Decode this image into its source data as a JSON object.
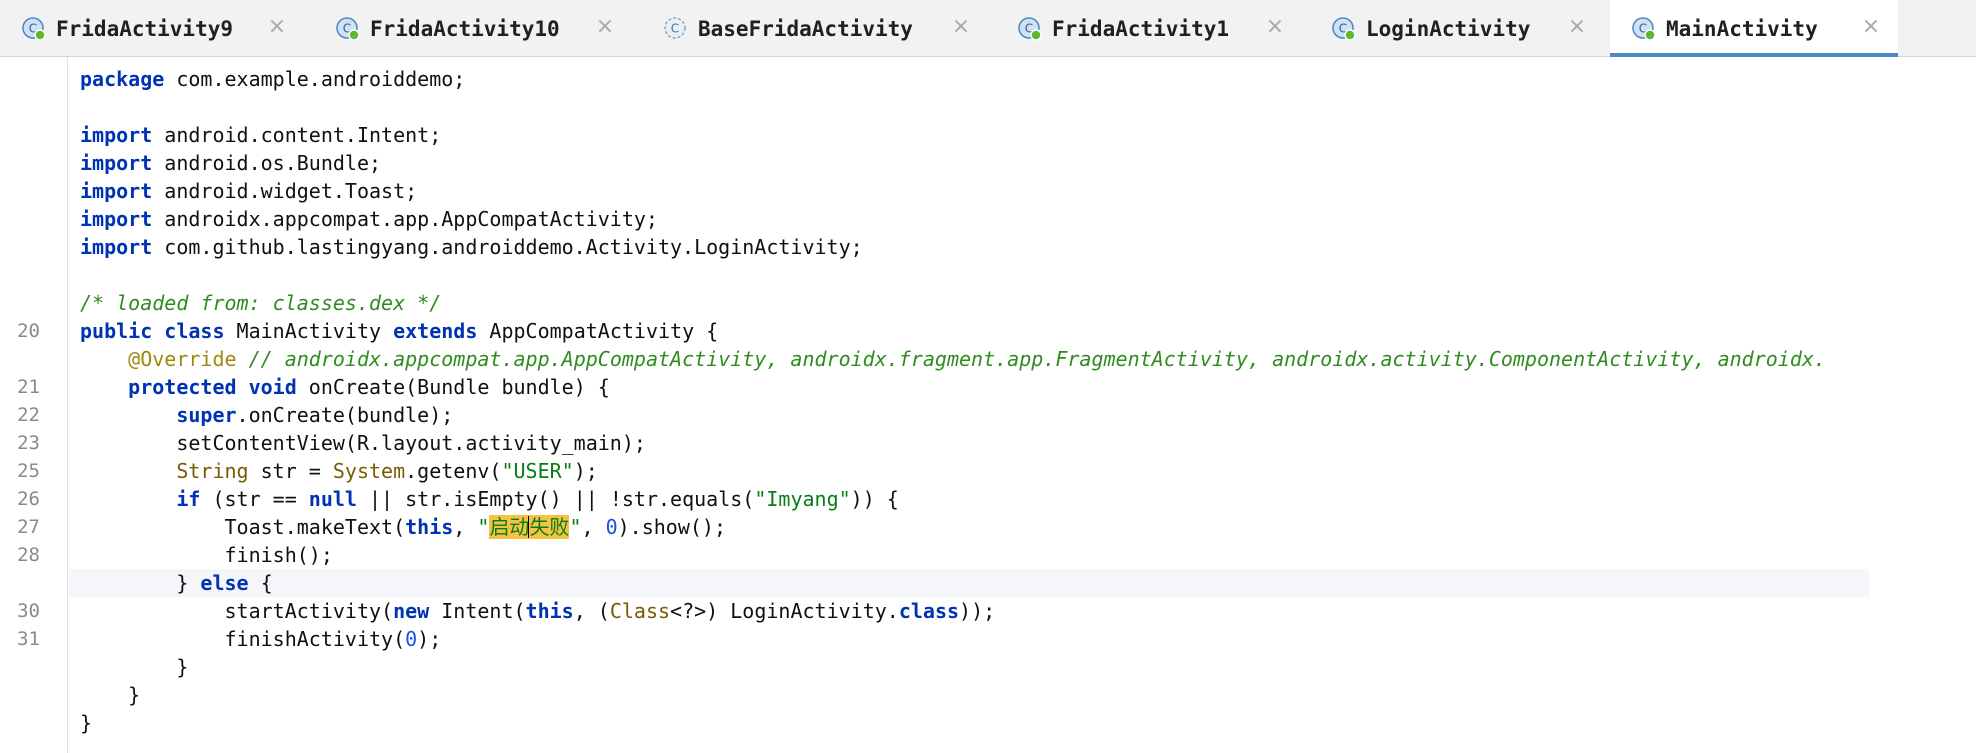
{
  "tabs": [
    {
      "label": "FridaActivity9",
      "active": false
    },
    {
      "label": "FridaActivity10",
      "active": false
    },
    {
      "label": "BaseFridaActivity",
      "active": false
    },
    {
      "label": "FridaActivity1",
      "active": false
    },
    {
      "label": "LoginActivity",
      "active": false
    },
    {
      "label": "MainActivity",
      "active": true
    }
  ],
  "close_glyph": "×",
  "icon": {
    "name": "java-class-icon",
    "letter": "C",
    "color_fill": "#cfe2f3",
    "color_stroke": "#4a88c7",
    "badge_color": "#5fb832"
  },
  "code": {
    "pkg_kw": "package",
    "pkg_name": " com.example.androiddemo;",
    "import_kw": "import",
    "imports": [
      " android.content.Intent;",
      " android.os.Bundle;",
      " android.widget.Toast;",
      " androidx.appcompat.app.AppCompatActivity;",
      " com.github.lastingyang.androiddemo.Activity.LoginActivity;"
    ],
    "loaded_comment": "/* loaded from: classes.dex */",
    "class_line": {
      "ln": "20",
      "public": "public",
      "class": "class",
      "name": " MainActivity ",
      "extends": "extends",
      "super": " AppCompatActivity {"
    },
    "override_line": {
      "annotation": "@Override",
      "comment": " // androidx.appcompat.app.AppCompatActivity, androidx.fragment.app.FragmentActivity, androidx.activity.ComponentActivity, androidx."
    },
    "oncreate_line": {
      "ln": "21",
      "protected": "protected",
      "void": "void",
      "rest": " onCreate(Bundle bundle) {"
    },
    "super_line": {
      "ln": "22",
      "super": "super",
      "rest": ".onCreate(bundle);"
    },
    "setcontent_line": {
      "ln": "23",
      "text": "setContentView(R.layout.activity_main);"
    },
    "getenv_line": {
      "ln": "25",
      "type": "String",
      "mid": " str = ",
      "system": "System",
      "call": ".getenv(",
      "arg": "\"USER\"",
      "end": ");"
    },
    "if_line": {
      "ln": "26",
      "if": "if",
      "a": " (str == ",
      "null": "null",
      "b": " || str.isEmpty() || !str.equals(",
      "arg": "\"Imyang\"",
      "end": ")) {"
    },
    "toast_line": {
      "ln": "27",
      "a": "Toast.makeText(",
      "this": "this",
      "b": ", ",
      "q1": "\"",
      "s1": "启动",
      "s2": "失败",
      "q2": "\"",
      "c": ", ",
      "zero": "0",
      "end": ").show();"
    },
    "finish_line": {
      "ln": "28",
      "text": "finish();"
    },
    "else_line": {
      "a": "} ",
      "else": "else",
      "b": " {"
    },
    "start_line": {
      "ln": "30",
      "a": "startActivity(",
      "new": "new",
      "b": " Intent(",
      "this": "this",
      "c": ", (",
      "cls": "Class",
      "d": "<?>) LoginActivity.",
      "class": "class",
      "end": "));"
    },
    "finishact_line": {
      "ln": "31",
      "a": "finishActivity(",
      "zero": "0",
      "end": ");"
    },
    "close1": "}",
    "close2": "}",
    "close3": "}"
  }
}
